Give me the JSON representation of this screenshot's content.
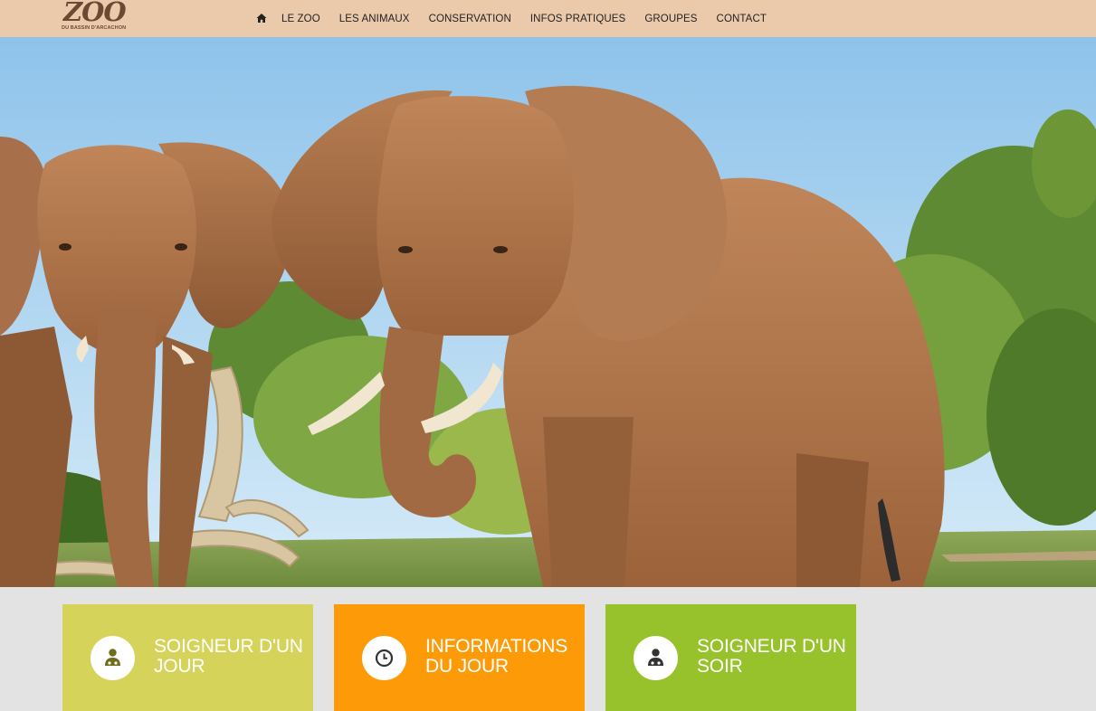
{
  "logo": {
    "title": "ZOO",
    "subtitle": "DU BASSIN D'ARCACHON"
  },
  "nav": {
    "home_icon": "home-icon",
    "items": [
      "LE ZOO",
      "LES ANIMAUX",
      "CONSERVATION",
      "INFOS PRATIQUES",
      "GROUPES",
      "CONTACT"
    ]
  },
  "hero": {
    "image": "elephants-photo"
  },
  "cards": [
    {
      "label": "SOIGNEUR D'UN JOUR",
      "icon": "zookeeper-icon",
      "color": "#d6d35a",
      "icon_color": "#6e6e1e"
    },
    {
      "label": "INFORMATIONS DU JOUR",
      "icon": "clock-icon",
      "color": "#fd9a08",
      "icon_color": "#333333"
    },
    {
      "label": "SOIGNEUR D'UN SOIR",
      "icon": "zookeeper-icon",
      "color": "#97c22b",
      "icon_color": "#333333"
    }
  ],
  "colors": {
    "topbar": "#ebcaac",
    "cards_background": "#e3e3e3",
    "logo": "#6b4a33"
  }
}
